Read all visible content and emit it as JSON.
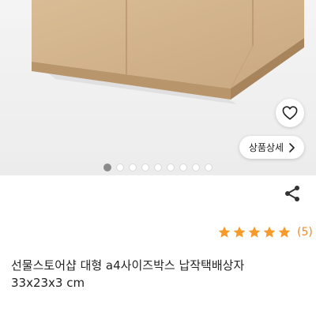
{
  "gallery": {
    "image_description_icon": "kraft-box-photo-icon",
    "total_slides": 9,
    "active_slide": 1
  },
  "actions": {
    "wishlist_icon": "heart-icon",
    "detail_button_label": "상품상세",
    "detail_button_icon": "chevron-right-icon",
    "share_icon": "share-icon"
  },
  "rating": {
    "stars": 5,
    "max_stars": 5,
    "review_count_label": "(5)",
    "star_color": "#f59a2b"
  },
  "product": {
    "title_line1": "선물스토어샵 대형 a4사이즈박스 납작택배상자",
    "title_line2": "33x23x3 cm"
  }
}
